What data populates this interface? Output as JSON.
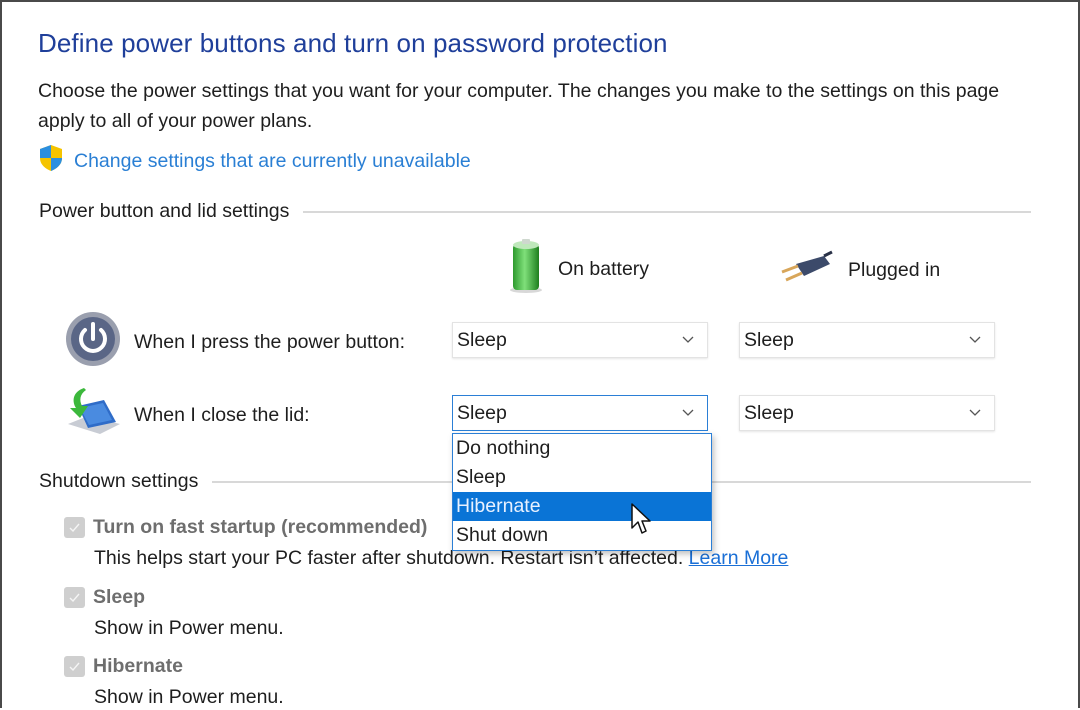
{
  "page": {
    "title": "Define power buttons and turn on password protection",
    "description": "Choose the power settings that you want for your computer. The changes you make to the settings on this page apply to all of your power plans.",
    "admin_link": "Change settings that are currently unavailable"
  },
  "power_section": {
    "heading": "Power button and lid settings",
    "columns": [
      {
        "label": "On battery",
        "icon": "battery-icon"
      },
      {
        "label": "Plugged in",
        "icon": "power-plug-icon"
      }
    ],
    "rows": [
      {
        "label": "When I press the power button:",
        "icon": "power-button-icon",
        "on_battery": "Sleep",
        "plugged_in": "Sleep"
      },
      {
        "label": "When I close the lid:",
        "icon": "laptop-lid-icon",
        "on_battery": "Sleep",
        "plugged_in": "Sleep"
      }
    ],
    "open_dropdown": {
      "options": [
        "Do nothing",
        "Sleep",
        "Hibernate",
        "Shut down"
      ],
      "highlighted": "Hibernate"
    }
  },
  "shutdown_section": {
    "heading": "Shutdown settings",
    "items": [
      {
        "label": "Turn on fast startup (recommended)",
        "checked": true,
        "description": "This helps start your PC faster after shutdown. Restart isn’t affected.",
        "link": "Learn More"
      },
      {
        "label": "Sleep",
        "checked": true,
        "description": "Show in Power menu."
      },
      {
        "label": "Hibernate",
        "checked": true,
        "description": "Show in Power menu."
      }
    ]
  },
  "colors": {
    "title": "#1f3f9a",
    "link": "#2a7fd4",
    "highlight": "#0a74d6"
  }
}
